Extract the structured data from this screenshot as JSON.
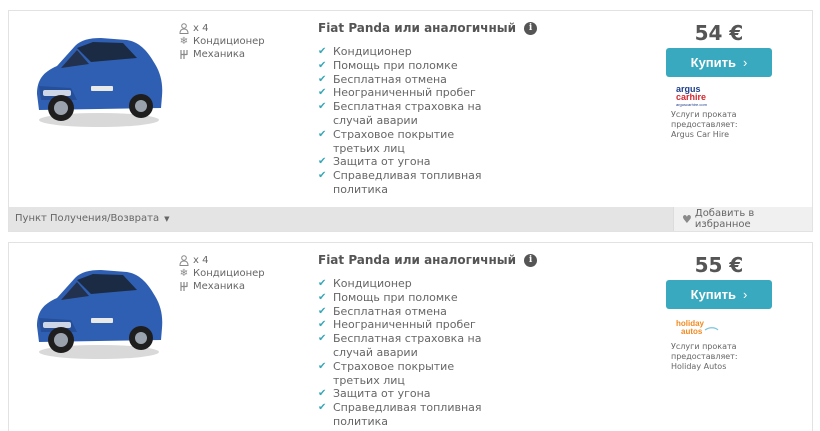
{
  "listings": [
    {
      "specs": {
        "seats": "x 4",
        "ac": "Кондиционер",
        "transmission": "Механика"
      },
      "title": "Fiat Panda или аналогичный",
      "features": [
        "Кондиционер",
        "Помощь при поломке",
        "Бесплатная отмена",
        "Неограниченный пробег",
        "Бесплатная страховка на случай аварии",
        "Страховое покрытие третьих лиц",
        "Защита от угона",
        "Справедливая топливная политика"
      ],
      "price": "54 €",
      "buy_label": "Купить",
      "logo": {
        "line1": "argus",
        "line2": "carhire",
        "line3": "arguscarhire.com"
      },
      "provider": {
        "line1": "Услуги проката",
        "line2": "предоставляет:",
        "line3": "Argus Car Hire"
      },
      "pickup_label": "Пункт Получения/Возврата",
      "favorite_label": "Добавить в избранное"
    },
    {
      "specs": {
        "seats": "x 4",
        "ac": "Кондиционер",
        "transmission": "Механика"
      },
      "title": "Fiat Panda или аналогичный",
      "features": [
        "Кондиционер",
        "Помощь при поломке",
        "Бесплатная отмена",
        "Неограниченный пробег",
        "Бесплатная страховка на случай аварии",
        "Страховое покрытие третьих лиц",
        "Защита от угона",
        "Справедливая топливная политика"
      ],
      "price": "55 €",
      "buy_label": "Купить",
      "logo": {
        "line1": "holiday",
        "line2": "autos"
      },
      "provider": {
        "line1": "Услуги проката",
        "line2": "предоставляет:",
        "line3": "Holiday Autos"
      }
    }
  ],
  "icons": {
    "person": "person-icon",
    "snowflake": "snowflake-icon",
    "gearbox": "gearbox-icon",
    "info": "info-icon",
    "check": "check-icon",
    "heart": "heart-icon"
  },
  "colors": {
    "accent": "#39a9bf",
    "check": "#3aa7b7",
    "car_body": "#2f5fb3",
    "argus_blue": "#1c3e8c",
    "argus_red": "#d4262e",
    "holiday_orange": "#f18a1f"
  }
}
